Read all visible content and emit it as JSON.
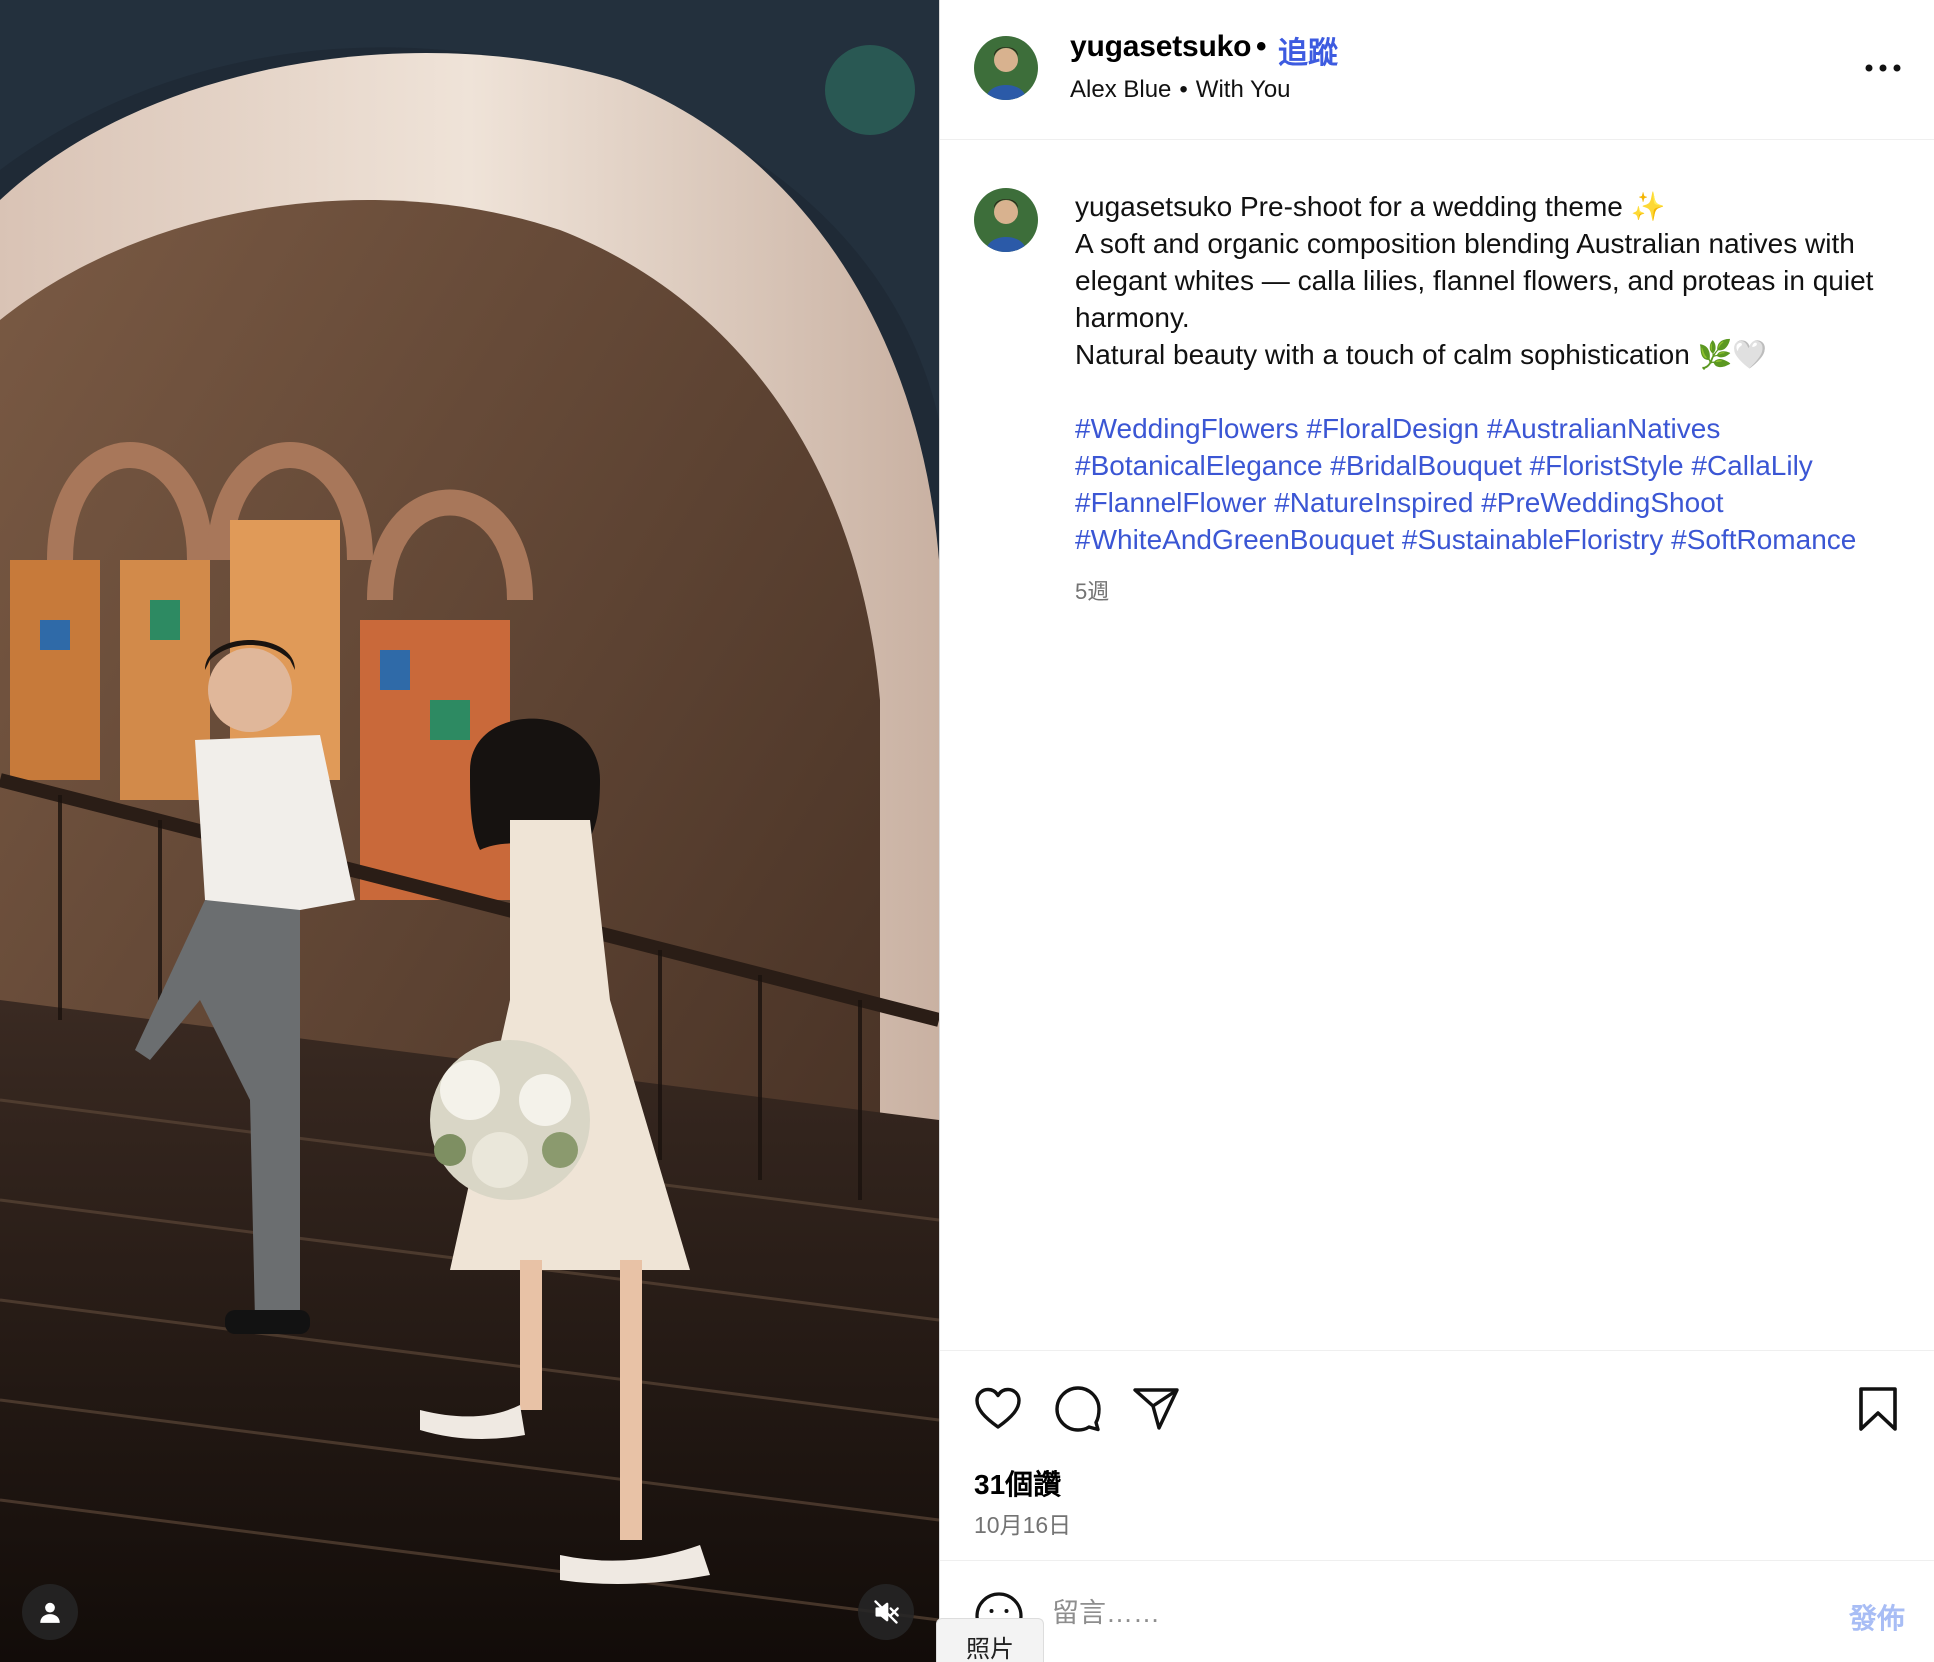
{
  "post": {
    "username": "yugasetsuko",
    "follow_label": "追蹤",
    "audio": {
      "artist": "Alex Blue",
      "track": "With You"
    },
    "caption": {
      "username": "yugasetsuko",
      "line1": "Pre-shoot for a wedding theme ✨",
      "line2": "A soft and organic composition blending Australian natives with elegant whites — calla lilies, flannel flowers, and proteas in quiet harmony.",
      "line3": "Natural beauty with a touch of calm sophistication 🌿🤍",
      "hashtags": [
        "#WeddingFlowers",
        "#FloralDesign",
        "#AustralianNatives",
        "#BotanicalElegance",
        "#BridalBouquet",
        "#FloristStyle",
        "#CallaLily",
        "#FlannelFlower",
        "#NatureInspired",
        "#PreWeddingShoot",
        "#WhiteAndGreenBouquet",
        "#SustainableFloristry",
        "#SoftRomance"
      ]
    },
    "age": "5週",
    "likes": "31個讚",
    "date": "10月16日"
  },
  "comment": {
    "placeholder": "留言……",
    "post_label": "發佈"
  },
  "media": {
    "tooltip": "照片"
  },
  "icons": {
    "more": "more-options-icon",
    "like": "heart-icon",
    "comment": "comment-bubble-icon",
    "share": "paper-plane-icon",
    "save": "bookmark-icon",
    "emoji": "smiley-icon",
    "tag": "person-icon",
    "mute": "speaker-muted-icon"
  },
  "colors": {
    "follow": "#3d5be0",
    "hashtag": "#3b56d4",
    "post_disabled": "#a8bdf5",
    "muted_text": "#737373"
  }
}
